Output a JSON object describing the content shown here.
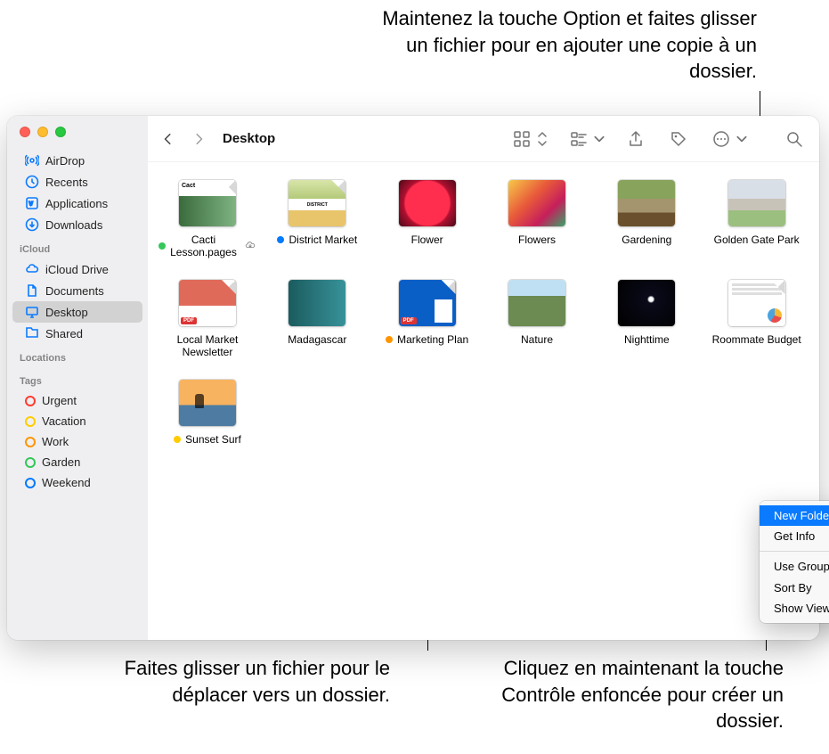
{
  "callouts": {
    "top": "Maintenez la touche Option et faites glisser un fichier pour en ajouter une copie à un dossier.",
    "bottom_left": "Faites glisser un fichier pour le déplacer vers un dossier.",
    "bottom_right": "Cliquez en maintenant la touche Contrôle enfoncée pour créer un dossier."
  },
  "window_title": "Desktop",
  "sidebar": {
    "favorites": [
      {
        "icon": "airdrop",
        "label": "AirDrop"
      },
      {
        "icon": "recents",
        "label": "Recents"
      },
      {
        "icon": "applications",
        "label": "Applications"
      },
      {
        "icon": "downloads",
        "label": "Downloads"
      }
    ],
    "sections": {
      "icloud_title": "iCloud",
      "locations_title": "Locations",
      "tags_title": "Tags"
    },
    "icloud": [
      {
        "icon": "icloud",
        "label": "iCloud Drive"
      },
      {
        "icon": "documents",
        "label": "Documents"
      },
      {
        "icon": "desktop",
        "label": "Desktop",
        "selected": true
      },
      {
        "icon": "shared",
        "label": "Shared"
      }
    ],
    "tags": [
      {
        "color": "#ff3b30",
        "label": "Urgent"
      },
      {
        "color": "#ffcc00",
        "label": "Vacation"
      },
      {
        "color": "#ff9500",
        "label": "Work"
      },
      {
        "color": "#34c759",
        "label": "Garden"
      },
      {
        "color": "#007aff",
        "label": "Weekend"
      }
    ]
  },
  "files": [
    {
      "name": "Cacti Lesson.pages",
      "tag": "#34c759",
      "thumb": "cacti",
      "cloud": true,
      "dogear": true
    },
    {
      "name": "District Market",
      "tag": "#007aff",
      "thumb": "district",
      "dogear": true
    },
    {
      "name": "Flower",
      "thumb": "flower"
    },
    {
      "name": "Flowers",
      "thumb": "flowers"
    },
    {
      "name": "Gardening",
      "thumb": "gardening"
    },
    {
      "name": "Golden Gate Park",
      "thumb": "ggp"
    },
    {
      "name": "Local Market Newsletter",
      "thumb": "local",
      "pdf": true,
      "dogear": true
    },
    {
      "name": "Madagascar",
      "thumb": "mad"
    },
    {
      "name": "Marketing Plan",
      "tag": "#ff9500",
      "thumb": "mark",
      "pdf": true,
      "dogear": true
    },
    {
      "name": "Nature",
      "thumb": "nature"
    },
    {
      "name": "Nighttime",
      "thumb": "night"
    },
    {
      "name": "Roommate Budget",
      "thumb": "room",
      "dogear": true
    },
    {
      "name": "Sunset Surf",
      "tag": "#ffcc00",
      "thumb": "sunset"
    }
  ],
  "context_menu": [
    {
      "label": "New Folder",
      "selected": true
    },
    {
      "label": "Get Info"
    },
    {
      "separator": true
    },
    {
      "label": "Use Groups"
    },
    {
      "label": "Sort By",
      "submenu": true
    },
    {
      "label": "Show View Options"
    }
  ]
}
